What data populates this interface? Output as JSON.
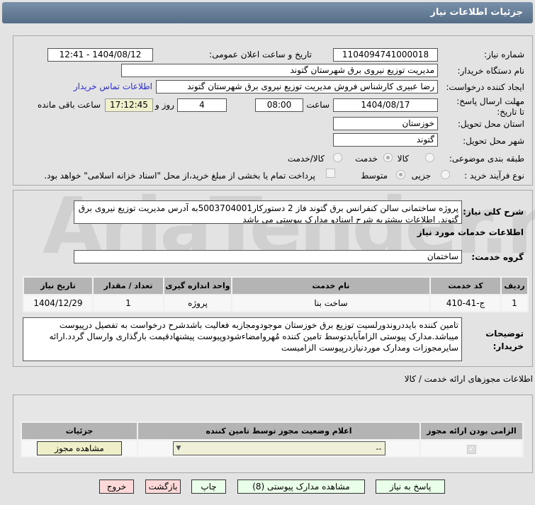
{
  "header": {
    "title": "جزئیات اطلاعات نیاز"
  },
  "watermark": "AriaTender.net",
  "form": {
    "need_number_label": "شماره نیاز:",
    "need_number": "1104094741000018",
    "announce_label": "تاریخ و ساعت اعلان عمومی:",
    "announce_value": "1404/08/12 - 12:41",
    "buyer_label": "نام دستگاه خریدار:",
    "buyer": "مدیریت توزیع نیروی برق شهرستان گتوند",
    "creator_label": "ایجاد کننده درخواست:",
    "creator": "رضا عبیری کارشناس فروش مدیریت توزیع نیروی برق شهرستان گتوند",
    "contact_link": "اطلاعات تماس خریدار",
    "deadline_label": "مهلت ارسال پاسخ: تا تاریخ:",
    "deadline_date": "1404/08/17",
    "time_label": "ساعت",
    "deadline_time": "08:00",
    "days": "4",
    "days_label": "روز و",
    "remaining": "17:12:45",
    "remaining_label": "ساعت باقی مانده",
    "province_label": "استان محل تحویل:",
    "province": "خوزستان",
    "city_label": "شهر محل تحویل:",
    "city": "گتوند",
    "category_label": "طبقه بندی موضوعی:",
    "category_options": [
      "کالا",
      "خدمت",
      "کالا/خدمت"
    ],
    "category_selected": "خدمت",
    "process_label": "نوع فرآیند خرید :",
    "process_options": [
      "جزیی",
      "متوسط"
    ],
    "process_selected": "متوسط",
    "payment_note": "پرداخت تمام یا بخشی از مبلغ خرید،از محل \"اسناد خزانه اسلامی\" خواهد بود."
  },
  "summary": {
    "label": "شرح کلی نیاز:",
    "text": "پروژه ساختمانی سالن کنفرانس برق گتوند فاز 2 دستورکار5003704001به آدرس مدیریت توزیع نیروی برق گتوند. اطلاعات بیشتربه شرح اسنادو مدارک پیوستی می باشد"
  },
  "services": {
    "title": "اطلاعات خدمات مورد نیاز",
    "group_label": "گروه خدمت:",
    "group": "ساختمان",
    "columns": [
      "ردیف",
      "کد خدمت",
      "نام خدمت",
      "واحد اندازه گیری",
      "تعداد / مقدار",
      "تاریخ نیاز"
    ],
    "rows": [
      [
        "1",
        "ج-41-410",
        "ساخت بنا",
        "پروژه",
        "1",
        "1404/12/29"
      ]
    ]
  },
  "buyer_notes": {
    "label": "توضیحات خریدار:",
    "text": "تامین کننده بایددروندورلسیت توزیع برق خوزستان موجودومجازبه فعالیت باشدشرح درخواست به تفصیل درپیوست میباشد.مدارک پیوستی الزاماًبایدتوسط تامین کننده مُهروامضاءشودوپیوست پیشنهادقیمت بارگذاری وارسال گردد.ارائه سایرمجوزات ومدارک موردنیازدرپیوست الزامیست"
  },
  "permits": {
    "title": "اطلاعات مجوزهای ارائه خدمت / کالا",
    "columns": [
      "الزامی بودن ارائه مجوز",
      "اعلام وضعیت مجوز توسط تامین کننده",
      "جزئیات"
    ],
    "required_checked": true,
    "status_value": "--",
    "view_button": "مشاهده مجوز"
  },
  "buttons": {
    "reply": "پاسخ به نیاز",
    "attachments": "مشاهده مدارک پیوستی (8)",
    "print": "چاپ",
    "back": "بازگشت",
    "exit": "خروج"
  }
}
